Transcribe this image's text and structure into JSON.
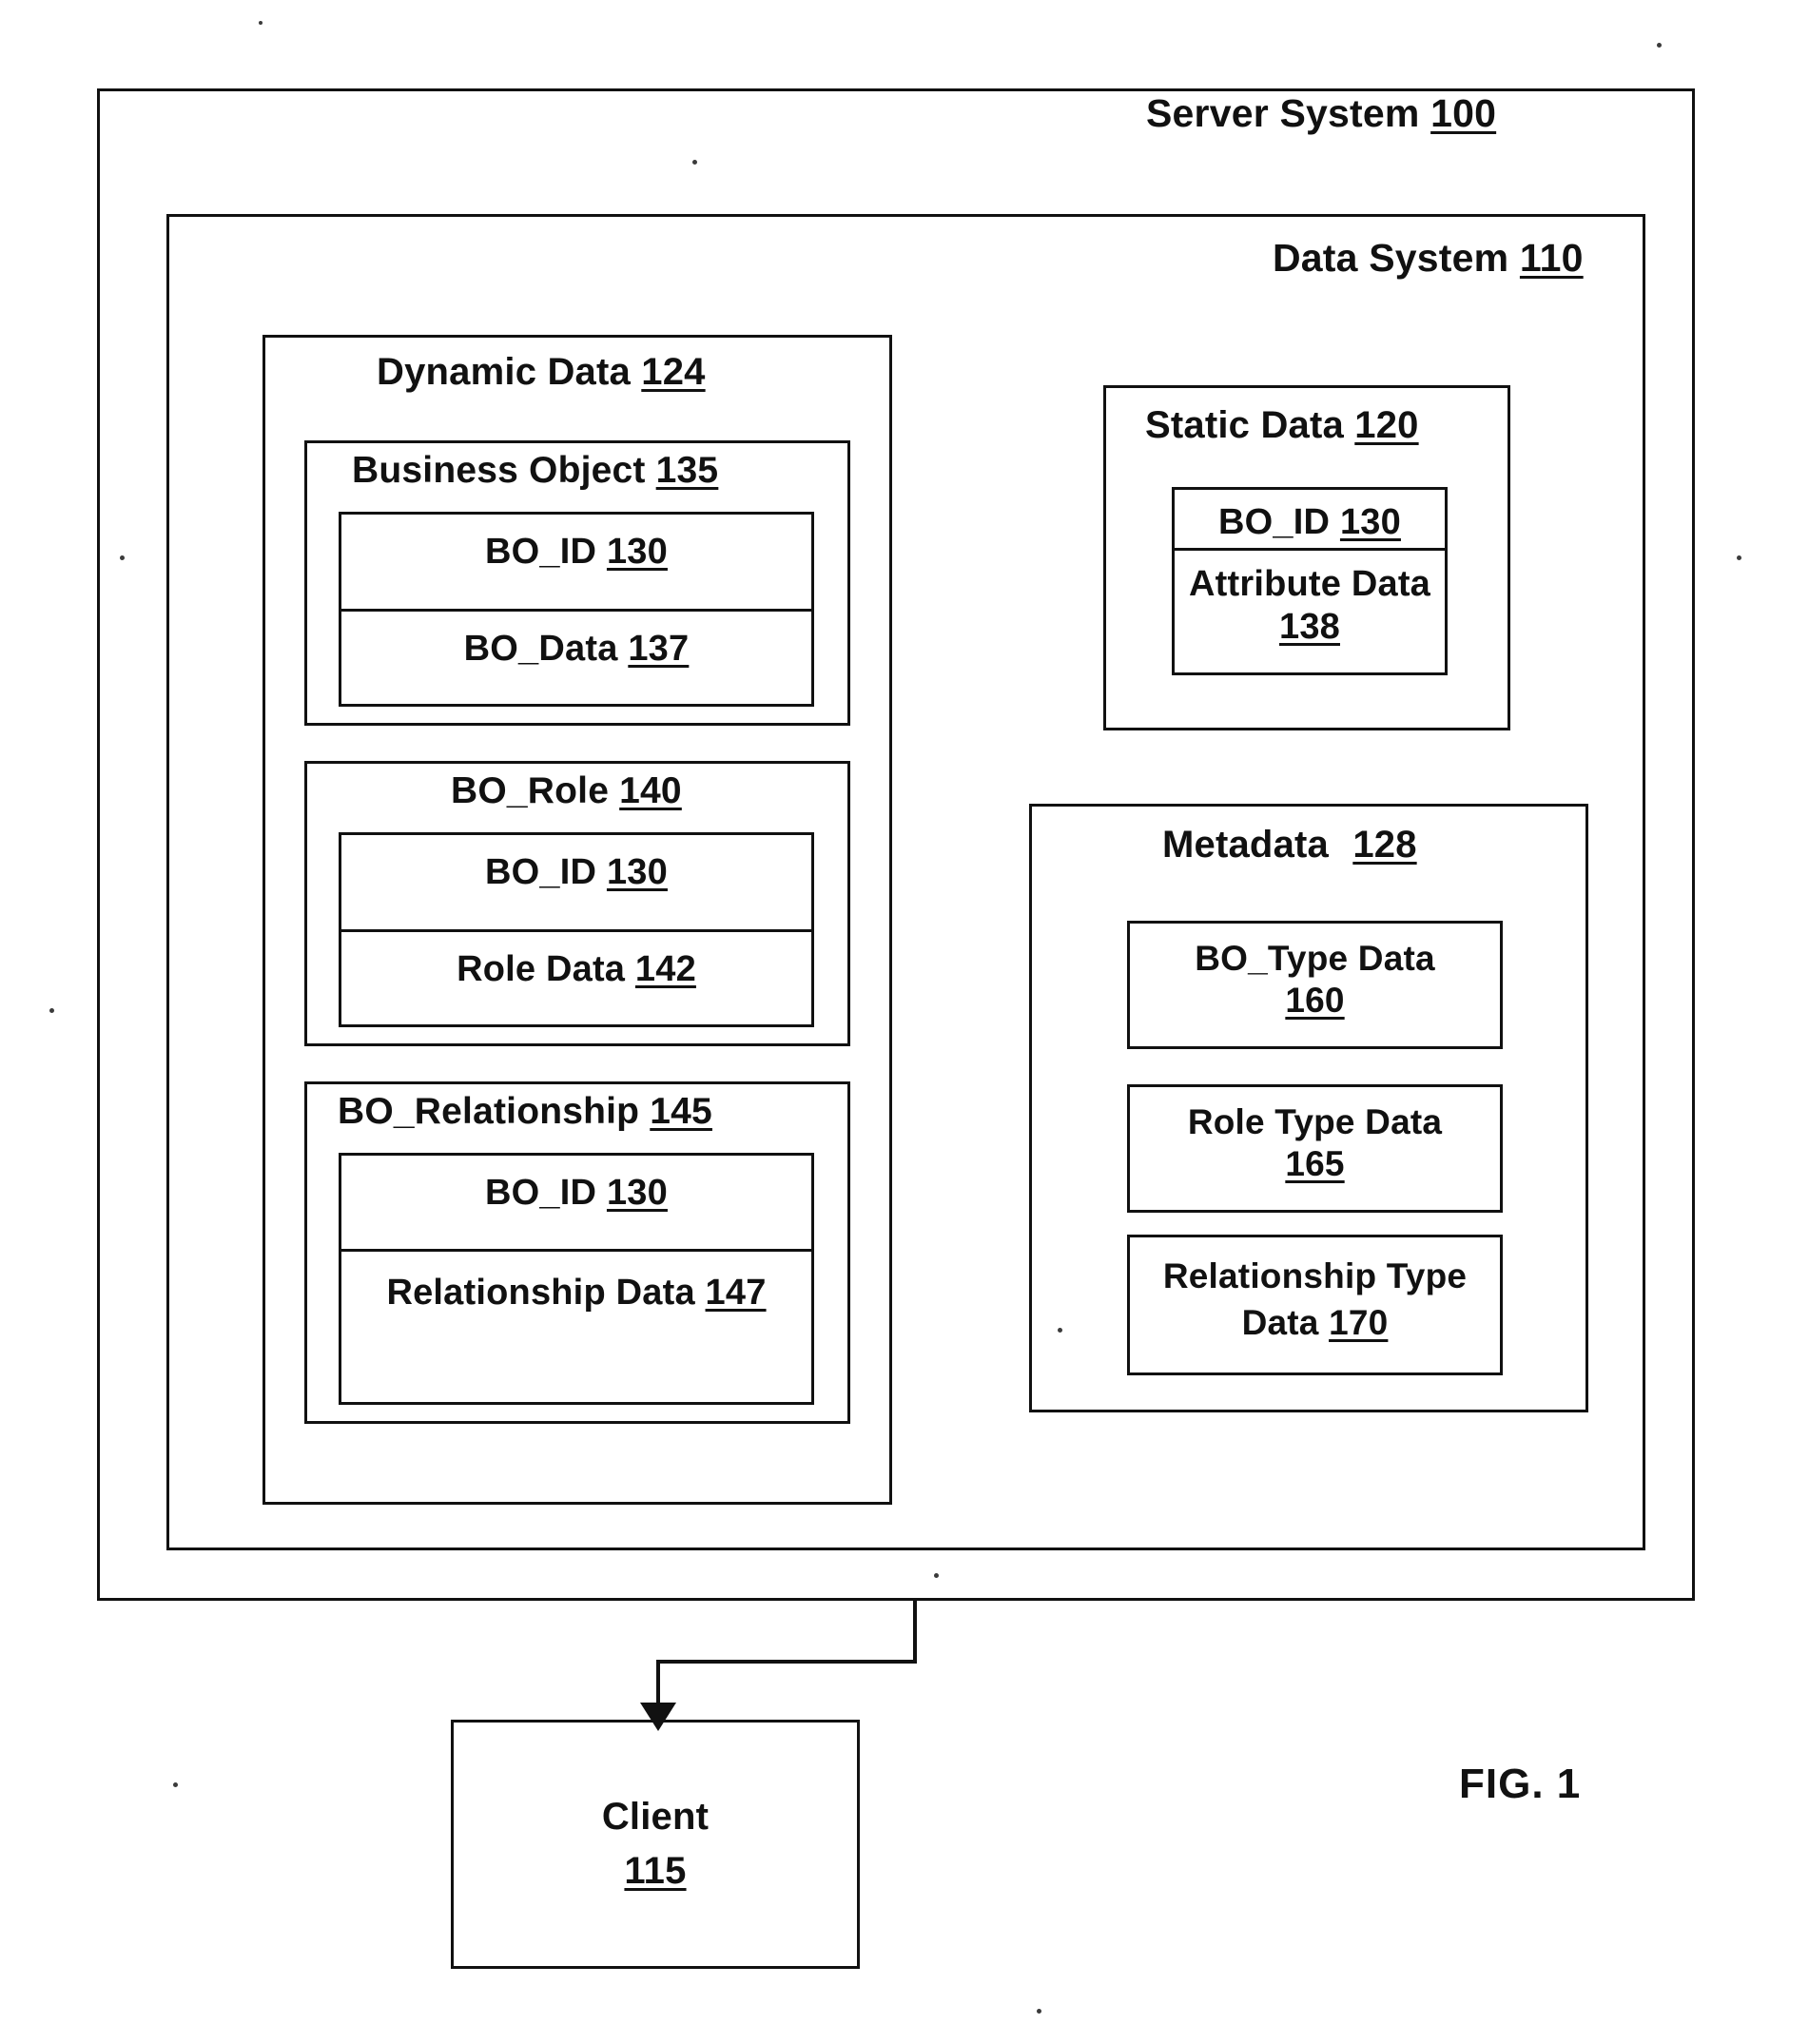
{
  "figure": {
    "caption": "FIG. 1"
  },
  "server_system": {
    "title": "Server System",
    "ref": "100"
  },
  "data_system": {
    "title": "Data System",
    "ref": "110"
  },
  "dynamic_data": {
    "title": "Dynamic Data",
    "ref": "124",
    "tables": [
      {
        "title": "Business Object",
        "ref": "135",
        "rows": [
          {
            "label": "BO_ID",
            "ref": "130"
          },
          {
            "label": "BO_Data",
            "ref": "137"
          }
        ]
      },
      {
        "title": "BO_Role",
        "ref": "140",
        "rows": [
          {
            "label": "BO_ID",
            "ref": "130"
          },
          {
            "label": "Role Data",
            "ref": "142"
          }
        ]
      },
      {
        "title": "BO_Relationship",
        "ref": "145",
        "rows": [
          {
            "label": "BO_ID",
            "ref": "130"
          },
          {
            "label": "Relationship Data",
            "ref": "147"
          }
        ]
      }
    ]
  },
  "static_data": {
    "title": "Static Data",
    "ref": "120",
    "table": {
      "rows": [
        {
          "label": "BO_ID",
          "ref": "130"
        },
        {
          "label": "Attribute Data",
          "ref": "138"
        }
      ]
    }
  },
  "metadata": {
    "title": "Metadata",
    "ref": "128",
    "items": [
      {
        "label": "BO_Type Data",
        "ref": "160"
      },
      {
        "label": "Role Type Data",
        "ref": "165"
      },
      {
        "label": "Relationship Type Data",
        "ref": "170"
      }
    ]
  },
  "client": {
    "title": "Client",
    "ref": "115"
  }
}
